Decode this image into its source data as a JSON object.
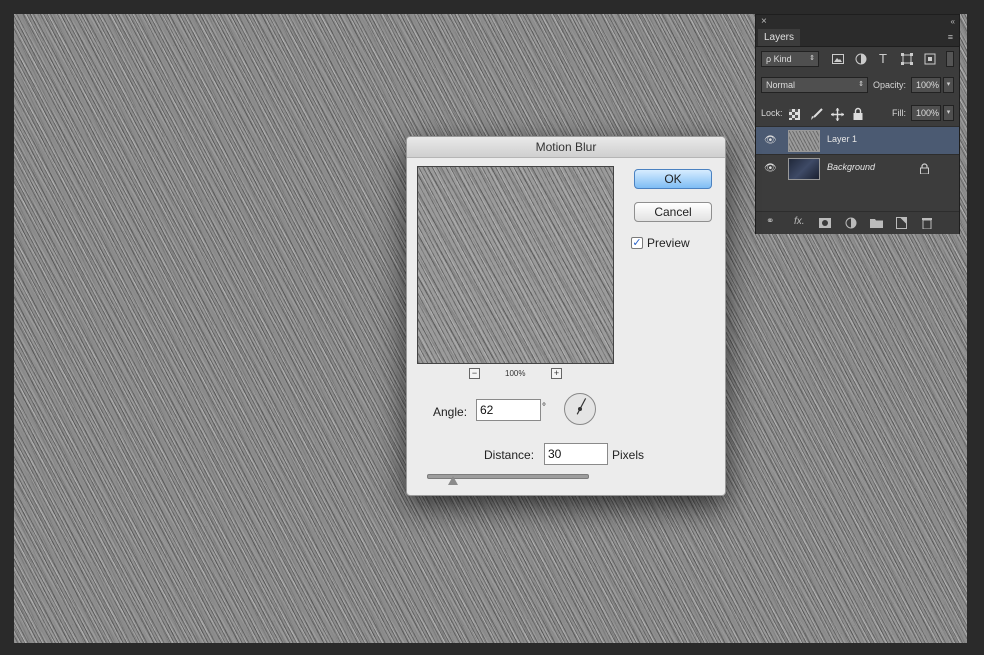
{
  "layers_panel": {
    "close_glyph": "×",
    "collapse_glyph": "«",
    "tab_label": "Layers",
    "menu_glyph": "≡",
    "kind_filter": "ρ Kind",
    "blend_mode": "Normal",
    "opacity_label": "Opacity:",
    "opacity_value": "100%",
    "lock_label": "Lock:",
    "fill_label": "Fill:",
    "fill_value": "100%",
    "filter_icons": [
      "image-filter-icon",
      "adjustment-filter-icon",
      "type-filter-icon",
      "shape-filter-icon",
      "smart-object-filter-icon"
    ],
    "lock_icons": [
      "lock-transparent-icon",
      "lock-image-icon",
      "lock-position-icon",
      "lock-all-icon"
    ],
    "layers": [
      {
        "name": "Layer 1",
        "selected": true,
        "visible": true,
        "locked": false
      },
      {
        "name": "Background",
        "selected": false,
        "visible": true,
        "locked": true
      }
    ],
    "footer_icons": [
      "link-icon",
      "fx-icon",
      "mask-icon",
      "adjustment-icon",
      "group-icon",
      "new-layer-icon",
      "trash-icon"
    ]
  },
  "dialog": {
    "title": "Motion Blur",
    "ok_label": "OK",
    "cancel_label": "Cancel",
    "preview_label": "Preview",
    "preview_checked": true,
    "zoom_out_glyph": "−",
    "zoom_in_glyph": "+",
    "zoom_level": "100%",
    "angle_label": "Angle:",
    "angle_value": "62",
    "angle_unit": "°",
    "distance_label": "Distance:",
    "distance_value": "30",
    "distance_unit": "Pixels",
    "slider_fraction": 0.16
  },
  "colors": {
    "ok_button": "#7fbdf4",
    "panel_bg": "#3c3c3c",
    "selected_layer": "#4b5a72"
  }
}
